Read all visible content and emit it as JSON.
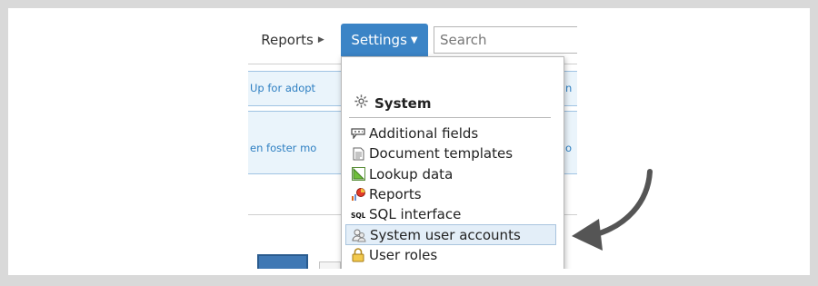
{
  "nav": {
    "reports_label": "Reports",
    "settings_label": "Settings"
  },
  "search": {
    "placeholder": "Search"
  },
  "background": {
    "link_1": "Up for adopt",
    "link_2": "en foster mo",
    "edge_char_1": "n",
    "edge_char_2": "o"
  },
  "menu": {
    "heading": "System",
    "items": [
      {
        "label": "Additional fields",
        "icon": "fields-icon"
      },
      {
        "label": "Document templates",
        "icon": "document-icon"
      },
      {
        "label": "Lookup data",
        "icon": "lookup-icon"
      },
      {
        "label": "Reports",
        "icon": "chart-icon"
      },
      {
        "label": "SQL interface",
        "icon": "sql-icon"
      },
      {
        "label": "System user accounts",
        "icon": "users-icon",
        "selected": true
      },
      {
        "label": "User roles",
        "icon": "lock-icon"
      }
    ]
  },
  "colors": {
    "accent": "#3b84c6",
    "selected_bg": "#e3eef8",
    "arrow": "#555555"
  }
}
